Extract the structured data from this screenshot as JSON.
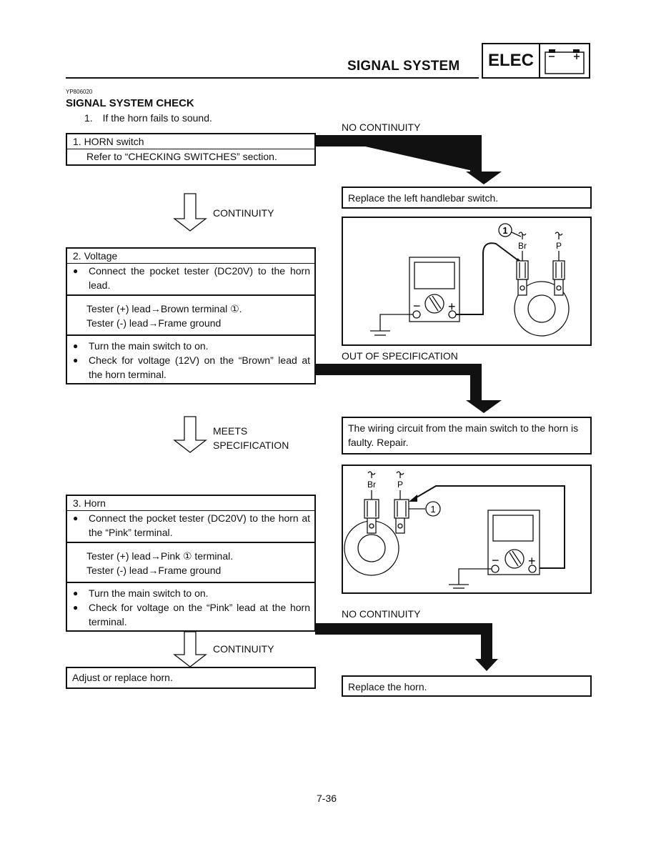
{
  "header": {
    "section_title": "SIGNAL SYSTEM",
    "category_label": "ELEC",
    "category_icon": "battery-icon"
  },
  "doc_code": "YP806020",
  "main": {
    "title": "SIGNAL SYSTEM CHECK",
    "intro_number": "1.",
    "intro_text": "If the horn fails to sound.",
    "steps": [
      {
        "heading": "1. HORN switch",
        "note": "Refer to “CHECKING SWITCHES” section."
      },
      {
        "heading": "2. Voltage",
        "bullets_a": [
          "Connect the pocket tester (DC20V) to the horn lead."
        ],
        "tester_lines": [
          "Tester (+) lead→Brown terminal ①.",
          "Tester (-) lead→Frame ground"
        ],
        "bullets_b": [
          "Turn the main switch to on.",
          "Check for voltage (12V) on the “Brown” lead at the horn terminal."
        ]
      },
      {
        "heading": "3. Horn",
        "bullets_a": [
          "Connect the pocket tester (DC20V) to the horn at the “Pink” terminal."
        ],
        "tester_lines": [
          "Tester (+) lead→Pink ① terminal.",
          "Tester (-) lead→Frame ground"
        ],
        "bullets_b": [
          "Turn the main switch to on.",
          "Check for voltage on the “Pink” lead at the horn terminal."
        ]
      }
    ],
    "flow_labels": {
      "step1_pass": "CONTINUITY",
      "step1_fail": "NO CONTINUITY",
      "step2_pass_line1": "MEETS",
      "step2_pass_line2": "SPECIFICATION",
      "step2_fail": "OUT OF SPECIFICATION",
      "step3_pass": "CONTINUITY",
      "step3_fail": "NO CONTINUITY"
    },
    "results": {
      "step1_fail": "Replace the left handlebar switch.",
      "step2_fail": "The wiring circuit from the main switch to the horn is faulty. Repair.",
      "step3_pass": "Adjust or replace horn.",
      "step3_fail": "Replace the horn."
    },
    "diagrams": {
      "callout": "1",
      "wire_brown": "Br",
      "wire_pink": "P",
      "tester_minus": "−",
      "tester_plus": "+"
    }
  },
  "page_number": "7-36"
}
